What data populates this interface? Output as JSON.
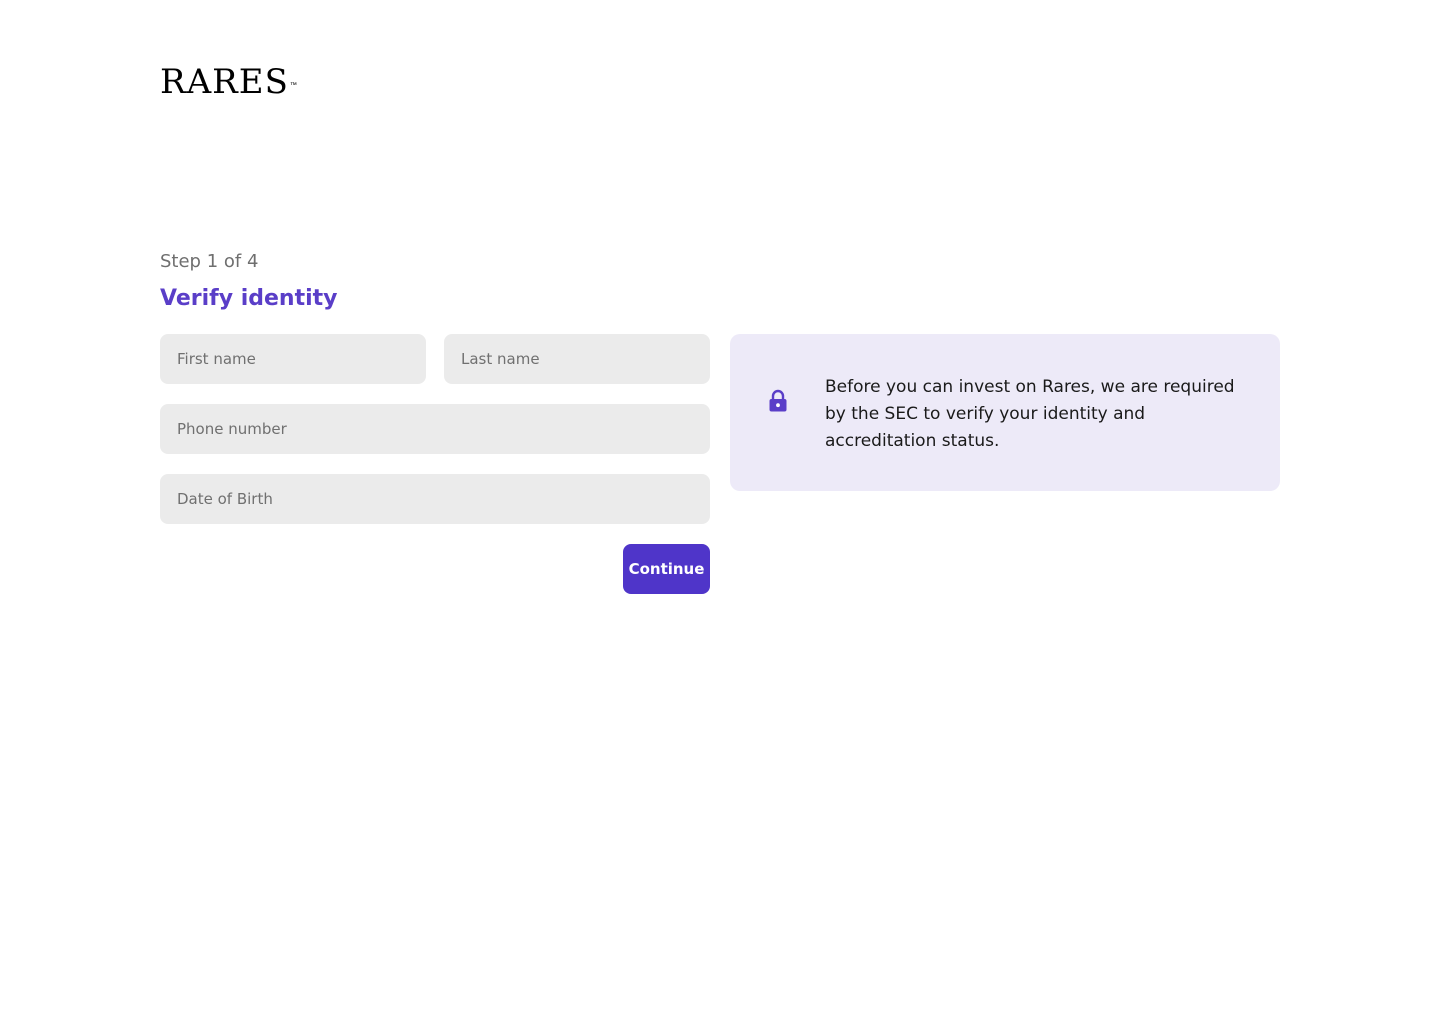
{
  "brand": {
    "logo_text": "RARES",
    "trademark": "™"
  },
  "progress": {
    "step_label": "Step 1 of 4"
  },
  "form": {
    "title": "Verify identity",
    "first_name_placeholder": "First name",
    "last_name_placeholder": "Last name",
    "phone_placeholder": "Phone number",
    "dob_placeholder": "Date of Birth",
    "continue_label": "Continue"
  },
  "info": {
    "icon": "lock-icon",
    "text": "Before you can invest on Rares, we are required by the SEC to verify your identity and accreditation status."
  },
  "colors": {
    "accent": "#4f35c9",
    "title": "#5a3ec8",
    "card_background": "#edeaf8",
    "input_background": "#ebebeb"
  }
}
